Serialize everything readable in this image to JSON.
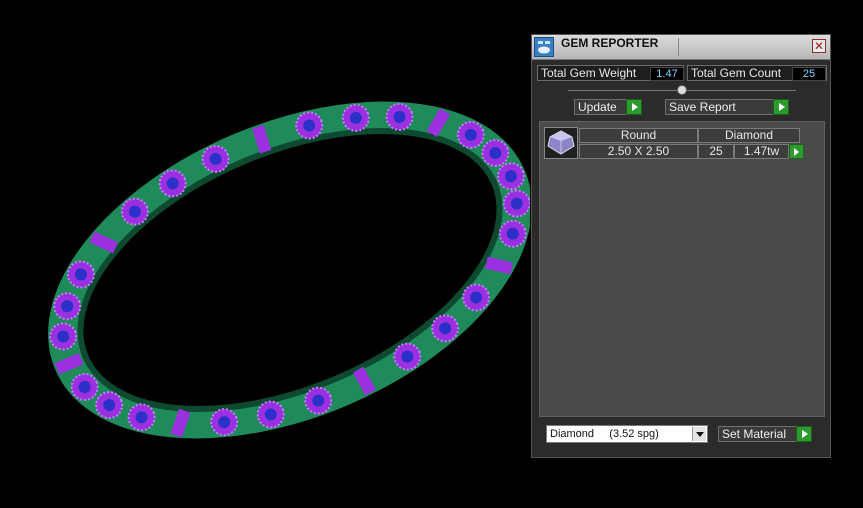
{
  "colors": {
    "band": "#1f8a5a",
    "band_dark": "#0d4a30",
    "gem_purple": "#9b30e0",
    "center_stone": "#2a30c8",
    "panel_bg": "#2b2b2b",
    "accent_green": "#2d9a2d",
    "value_text": "#7fd6ff"
  },
  "window": {
    "title": "GEM REPORTER",
    "close_icon": "close-icon"
  },
  "stats": {
    "weight_label": "Total Gem Weight",
    "weight_value": "1.47",
    "count_label": "Total Gem Count",
    "count_value": "25"
  },
  "toolbar": {
    "update_label": "Update",
    "save_label": "Save Report"
  },
  "gems": [
    {
      "shape": "Round",
      "size": "2.50 X 2.50",
      "material": "Diamond",
      "count": "25",
      "weight": "1.47tw"
    }
  ],
  "footer": {
    "material_selected": "Diamond     (3.52 spg)",
    "set_material_label": "Set Material"
  }
}
